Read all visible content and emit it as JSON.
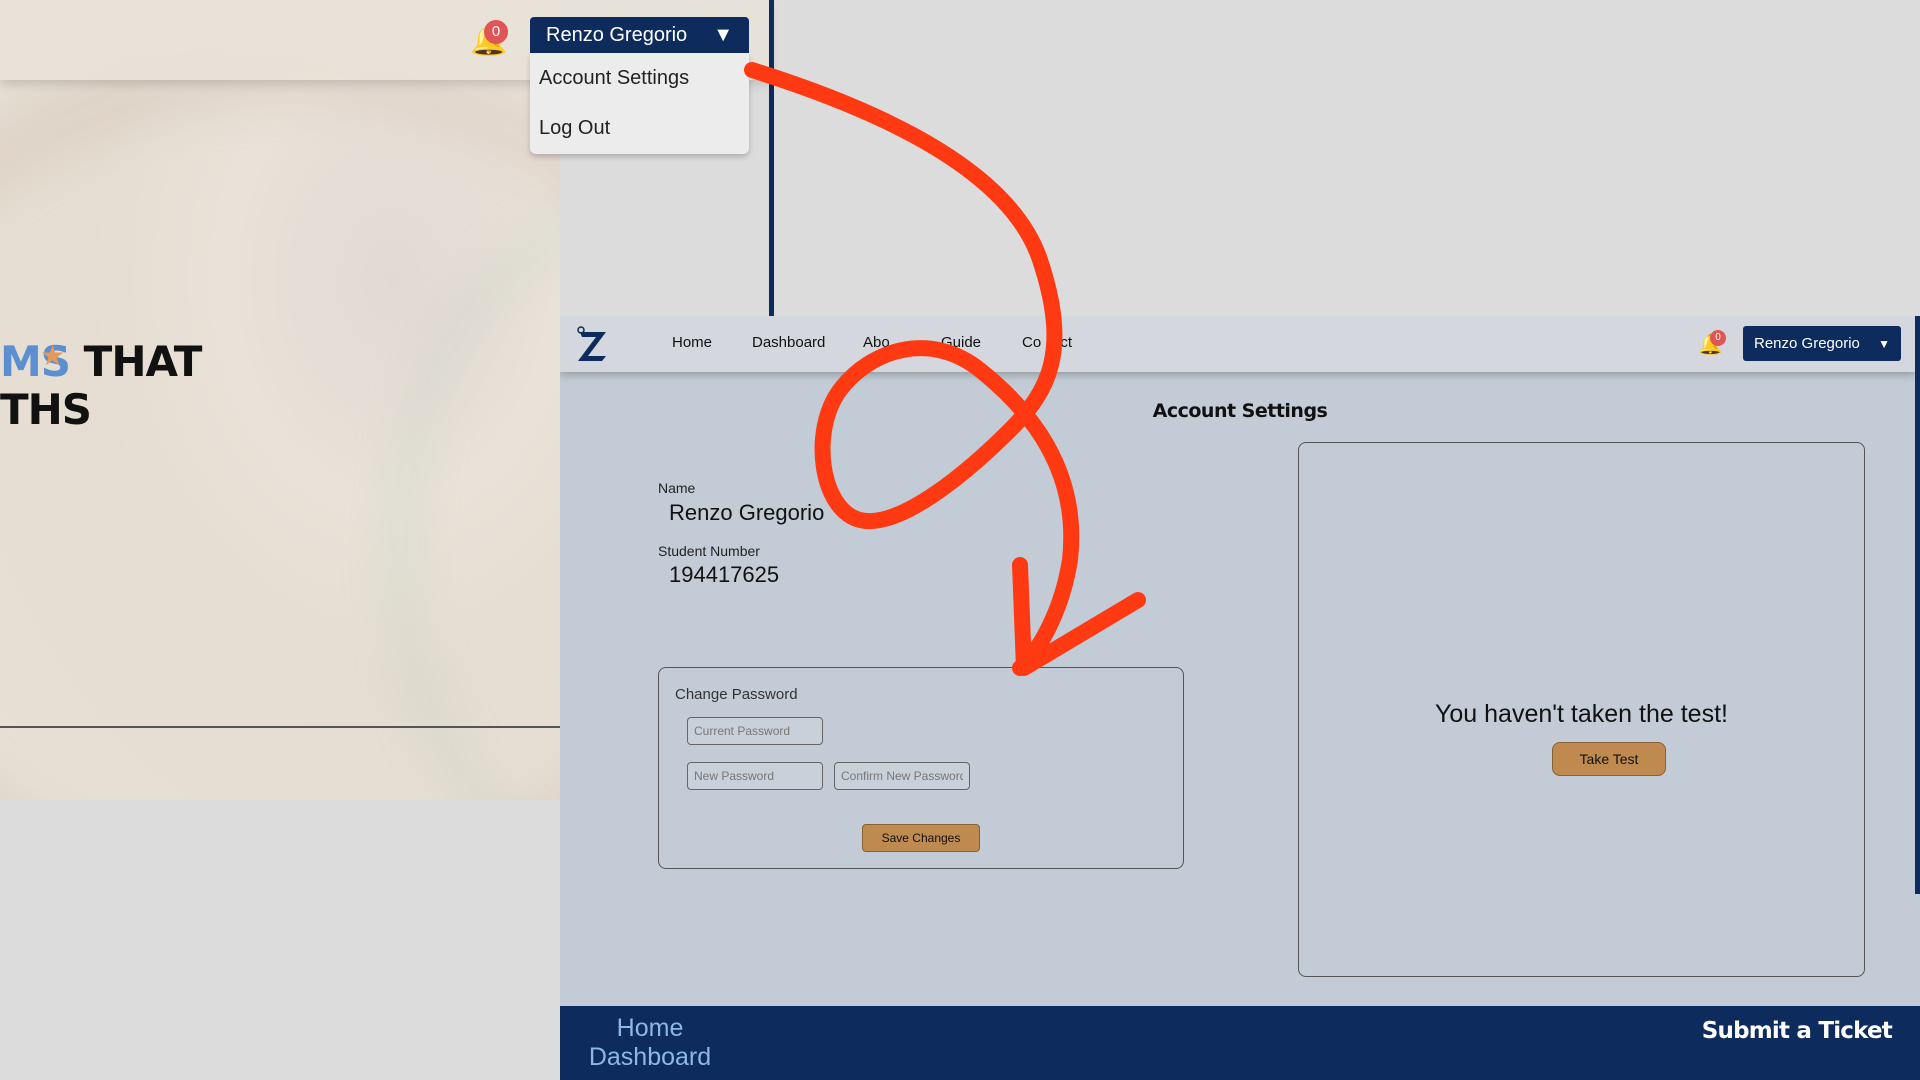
{
  "background_screenshot": {
    "notification_count": "0",
    "user_menu": {
      "name": "Renzo Gregorio",
      "caret": "▼",
      "items": [
        "Account Settings",
        "Log Out"
      ]
    },
    "hero_line1_accent": "MS",
    "hero_line1_rest": "THAT",
    "hero_line2": "THS"
  },
  "navbar": {
    "items": [
      "Home",
      "Dashboard",
      "Abo",
      "Guide",
      "Co",
      "act"
    ],
    "notification_count": "0",
    "user_name": "Renzo Gregorio",
    "caret": "▼"
  },
  "page": {
    "title": "Account Settings",
    "name_label": "Name",
    "name_value": "Renzo Gregorio",
    "student_number_label": "Student Number",
    "student_number_value": "194417625"
  },
  "change_password": {
    "title": "Change Password",
    "current_placeholder": "Current Password",
    "new_placeholder": "New Password",
    "confirm_placeholder": "Confirm New Password",
    "save_label": "Save Changes"
  },
  "test_panel": {
    "message": "You haven't taken the test!",
    "button_label": "Take Test"
  },
  "footer": {
    "links": [
      "Home",
      "Dashboard"
    ],
    "ticket_label": "Submit a Ticket"
  },
  "colors": {
    "navy": "#0d2b5c",
    "button_tan": "#bf8a4f",
    "annotation_red": "#ff3a12",
    "badge_red": "#e05555",
    "bell_yellow": "#e0a63a"
  }
}
